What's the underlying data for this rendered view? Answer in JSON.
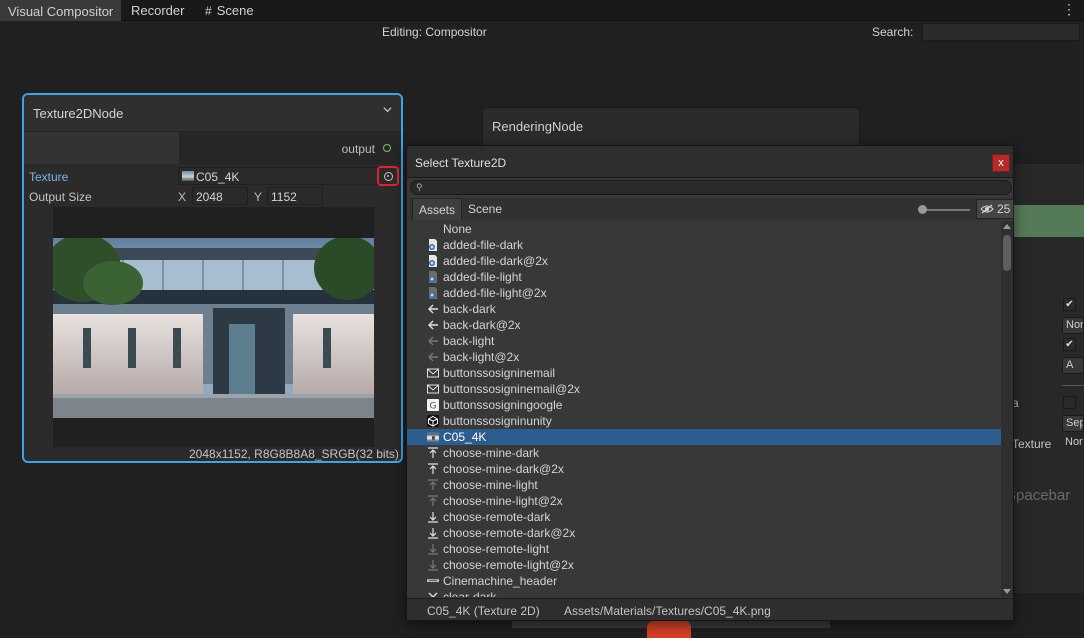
{
  "tabs": {
    "items": [
      {
        "label": "Visual Compositor"
      },
      {
        "label": "Recorder"
      },
      {
        "label": "Scene",
        "icon": "grid-icon"
      }
    ],
    "menu_glyph": "⋮"
  },
  "toolbar": {
    "editing_label": "Editing: Compositor",
    "search_label": "Search:"
  },
  "texture_node": {
    "title": "Texture2DNode",
    "output_port": "output",
    "texture_label": "Texture",
    "texture_value": "C05_4K",
    "output_size_label": "Output Size",
    "x_label": "X",
    "x_value": "2048",
    "y_label": "Y",
    "y_value": "1152",
    "caption": "2048x1152, R8G8B8A8_SRGB(32 bits)",
    "accent_color": "#3da4e8"
  },
  "rendering_node": {
    "title": "RenderingNode"
  },
  "inspector": {
    "dropdown_a": "Nor",
    "dropdown_b": "A",
    "dropdown_c": "Sep",
    "dropdown_d": "Nor",
    "label_a": "a",
    "label_texture": "Texture",
    "spacebar_hint": "Spacebar"
  },
  "popup": {
    "title": "Select Texture2D",
    "close_glyph": "x",
    "tabs": {
      "assets": "Assets",
      "scene": "Scene"
    },
    "visible_count": "25",
    "items": [
      {
        "label": "None",
        "icon": "none"
      },
      {
        "label": "added-file-dark",
        "icon": "file-add-icon"
      },
      {
        "label": "added-file-dark@2x",
        "icon": "file-add-icon"
      },
      {
        "label": "added-file-light",
        "icon": "file-add-light-icon"
      },
      {
        "label": "added-file-light@2x",
        "icon": "file-add-light-icon"
      },
      {
        "label": "back-dark",
        "icon": "arrow-left-icon"
      },
      {
        "label": "back-dark@2x",
        "icon": "arrow-left-icon"
      },
      {
        "label": "back-light",
        "icon": "arrow-left-light-icon"
      },
      {
        "label": "back-light@2x",
        "icon": "arrow-left-light-icon"
      },
      {
        "label": "buttonssosigninemail",
        "icon": "mail-icon"
      },
      {
        "label": "buttonssosigninemail@2x",
        "icon": "mail-icon"
      },
      {
        "label": "buttonssosigningoogle",
        "icon": "google-icon"
      },
      {
        "label": "buttonssosigninunity",
        "icon": "unity-icon"
      },
      {
        "label": "C05_4K",
        "icon": "texture-thumbnail-icon",
        "selected": true
      },
      {
        "label": "choose-mine-dark",
        "icon": "arrow-up-icon"
      },
      {
        "label": "choose-mine-dark@2x",
        "icon": "arrow-up-icon"
      },
      {
        "label": "choose-mine-light",
        "icon": "arrow-up-light-icon"
      },
      {
        "label": "choose-mine-light@2x",
        "icon": "arrow-up-light-icon"
      },
      {
        "label": "choose-remote-dark",
        "icon": "arrow-down-icon"
      },
      {
        "label": "choose-remote-dark@2x",
        "icon": "arrow-down-icon"
      },
      {
        "label": "choose-remote-light",
        "icon": "arrow-down-light-icon"
      },
      {
        "label": "choose-remote-light@2x",
        "icon": "arrow-down-light-icon"
      },
      {
        "label": "Cinemachine_header",
        "icon": "header-icon"
      },
      {
        "label": "clear-dark",
        "icon": "close-icon"
      }
    ],
    "status_type": "C05_4K (Texture 2D)",
    "status_path": "Assets/Materials/Textures/C05_4K.png",
    "selection_color": "#2c5d8f",
    "close_color": "#b52a2a"
  }
}
